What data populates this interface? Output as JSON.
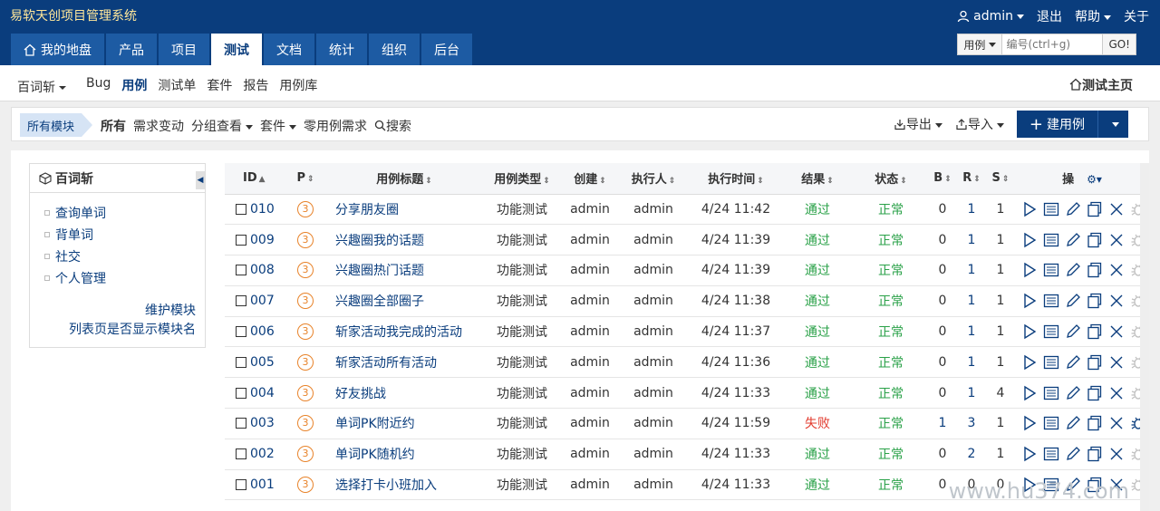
{
  "app": {
    "title": "易软天创项目管理系统"
  },
  "user": {
    "name": "admin",
    "logout": "退出",
    "help": "帮助",
    "about": "关于"
  },
  "nav": [
    "我的地盘",
    "产品",
    "项目",
    "测试",
    "文档",
    "统计",
    "组织",
    "后台"
  ],
  "nav_active": 3,
  "search": {
    "type": "用例",
    "placeholder": "编号(ctrl+g)",
    "go": "GO!"
  },
  "subnav": {
    "product": "百词斩",
    "links": [
      "Bug",
      "用例",
      "测试单",
      "套件",
      "报告",
      "用例库"
    ],
    "active": 1,
    "home": "测试主页"
  },
  "toolbar": {
    "module_tag": "所有模块",
    "filters": [
      "所有",
      "需求变动",
      "分组查看",
      "套件",
      "零用例需求",
      "搜索"
    ],
    "export": "导出",
    "import": "导入",
    "new_case": "建用例"
  },
  "sidebar": {
    "title": "百词斩",
    "items": [
      "查询单词",
      "背单词",
      "社交",
      "个人管理"
    ],
    "maintain": "维护模块",
    "show_module": "列表页是否显示模块名"
  },
  "table": {
    "headers": [
      "ID",
      "P",
      "用例标题",
      "用例类型",
      "创建",
      "执行人",
      "执行时间",
      "结果",
      "状态",
      "B",
      "R",
      "S",
      "操"
    ],
    "rows": [
      {
        "id": "010",
        "p": "3",
        "title": "分享朋友圈",
        "type": "功能测试",
        "creator": "admin",
        "executor": "admin",
        "time": "4/24 11:42",
        "result": "通过",
        "status": "正常",
        "b": "0",
        "r": "1",
        "s": "1"
      },
      {
        "id": "009",
        "p": "3",
        "title": "兴趣圈我的话题",
        "type": "功能测试",
        "creator": "admin",
        "executor": "admin",
        "time": "4/24 11:39",
        "result": "通过",
        "status": "正常",
        "b": "0",
        "r": "1",
        "s": "1"
      },
      {
        "id": "008",
        "p": "3",
        "title": "兴趣圈热门话题",
        "type": "功能测试",
        "creator": "admin",
        "executor": "admin",
        "time": "4/24 11:39",
        "result": "通过",
        "status": "正常",
        "b": "0",
        "r": "1",
        "s": "1"
      },
      {
        "id": "007",
        "p": "3",
        "title": "兴趣圈全部圈子",
        "type": "功能测试",
        "creator": "admin",
        "executor": "admin",
        "time": "4/24 11:38",
        "result": "通过",
        "status": "正常",
        "b": "0",
        "r": "1",
        "s": "1"
      },
      {
        "id": "006",
        "p": "3",
        "title": "斩家活动我完成的活动",
        "type": "功能测试",
        "creator": "admin",
        "executor": "admin",
        "time": "4/24 11:37",
        "result": "通过",
        "status": "正常",
        "b": "0",
        "r": "1",
        "s": "1"
      },
      {
        "id": "005",
        "p": "3",
        "title": "斩家活动所有活动",
        "type": "功能测试",
        "creator": "admin",
        "executor": "admin",
        "time": "4/24 11:36",
        "result": "通过",
        "status": "正常",
        "b": "0",
        "r": "1",
        "s": "1"
      },
      {
        "id": "004",
        "p": "3",
        "title": "好友挑战",
        "type": "功能测试",
        "creator": "admin",
        "executor": "admin",
        "time": "4/24 11:33",
        "result": "通过",
        "status": "正常",
        "b": "0",
        "r": "1",
        "s": "4"
      },
      {
        "id": "003",
        "p": "3",
        "title": "单词PK附近约",
        "type": "功能测试",
        "creator": "admin",
        "executor": "admin",
        "time": "4/24 11:59",
        "result": "失败",
        "status": "正常",
        "b": "1",
        "r": "3",
        "s": "1"
      },
      {
        "id": "002",
        "p": "3",
        "title": "单词PK随机约",
        "type": "功能测试",
        "creator": "admin",
        "executor": "admin",
        "time": "4/24 11:33",
        "result": "通过",
        "status": "正常",
        "b": "0",
        "r": "2",
        "s": "1"
      },
      {
        "id": "001",
        "p": "3",
        "title": "选择打卡小班加入",
        "type": "功能测试",
        "creator": "admin",
        "executor": "admin",
        "time": "4/24 11:33",
        "result": "通过",
        "status": "正常",
        "b": "0",
        "r": "0",
        "s": "0"
      }
    ]
  },
  "watermark": "www.hu374.com",
  "colors": {
    "header": "#0a3d7d",
    "nav": "#1d5ba3",
    "pass": "#2aa148",
    "fail": "#e23b2e",
    "priority": "#e8832a"
  }
}
